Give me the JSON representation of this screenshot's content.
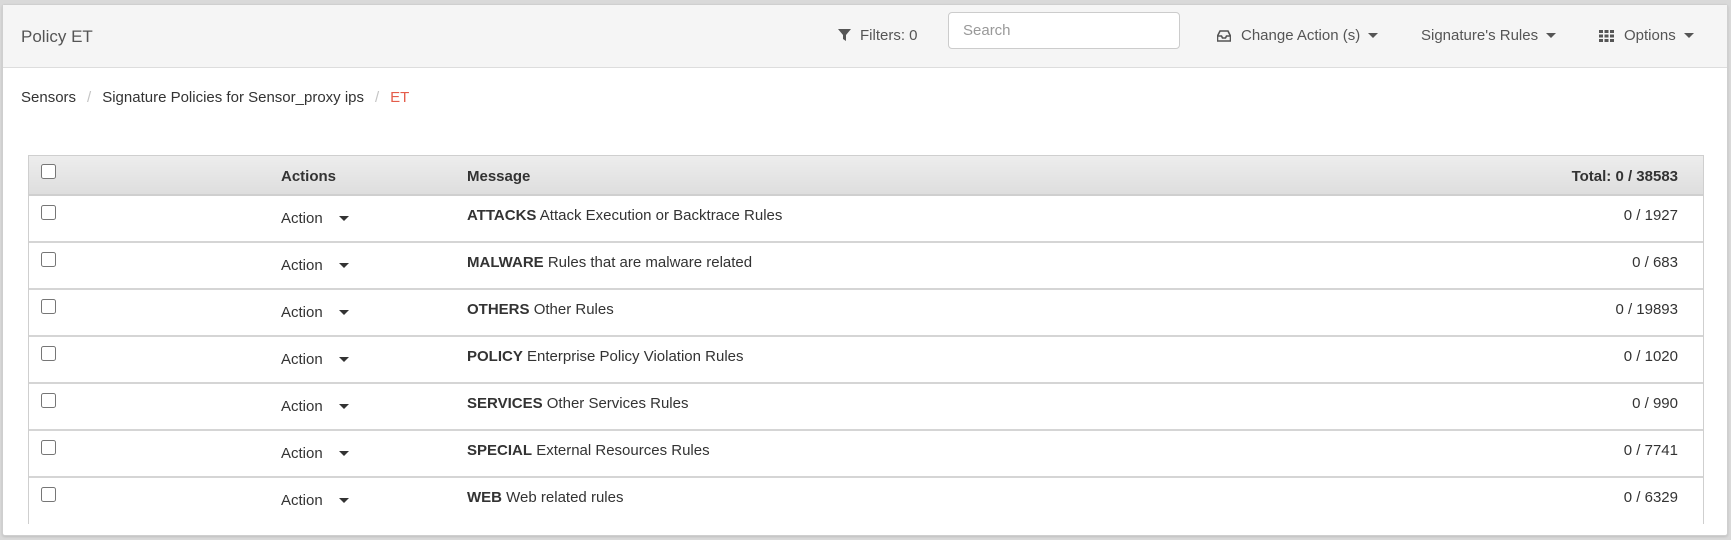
{
  "header": {
    "title": "Policy ET",
    "filters_label": "Filters: 0",
    "search_placeholder": "Search",
    "change_action_label": "Change Action (s)",
    "signature_rules_label": "Signature's Rules",
    "options_label": "Options"
  },
  "breadcrumb": {
    "items": [
      "Sensors",
      "Signature Policies for Sensor_proxy ips"
    ],
    "separator": "/",
    "active": "ET"
  },
  "table": {
    "headers": {
      "actions": "Actions",
      "message": "Message",
      "total": "Total: 0 / 38583"
    },
    "rows": [
      {
        "action": "Action",
        "category": "ATTACKS",
        "description": "Attack Execution or Backtrace Rules",
        "count": "0 / 1927"
      },
      {
        "action": "Action",
        "category": "MALWARE",
        "description": "Rules that are malware related",
        "count": "0 / 683"
      },
      {
        "action": "Action",
        "category": "OTHERS",
        "description": "Other Rules",
        "count": "0 / 19893"
      },
      {
        "action": "Action",
        "category": "POLICY",
        "description": "Enterprise Policy Violation Rules",
        "count": "0 / 1020"
      },
      {
        "action": "Action",
        "category": "SERVICES",
        "description": "Other Services Rules",
        "count": "0 / 990"
      },
      {
        "action": "Action",
        "category": "SPECIAL",
        "description": "External Resources Rules",
        "count": "0 / 7741"
      },
      {
        "action": "Action",
        "category": "WEB",
        "description": "Web related rules",
        "count": "0 / 6329"
      }
    ]
  },
  "icons": {
    "filters": "filter-icon",
    "change_action": "inbox-icon",
    "options": "grid-icon",
    "caret": "caret-down-icon"
  },
  "colors": {
    "breadcrumb_active": "#e45d4b",
    "header_bg": "#f5f5f5"
  }
}
